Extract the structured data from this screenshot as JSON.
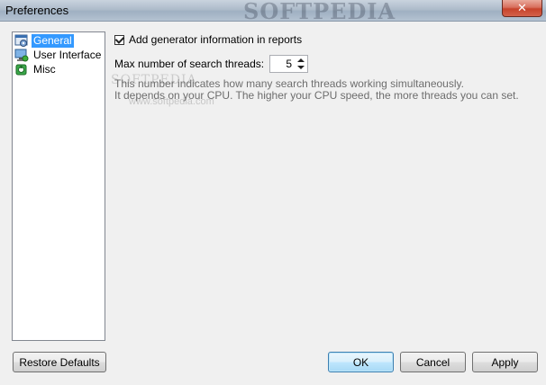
{
  "window": {
    "title": "Preferences",
    "watermark": "SOFTPEDIA",
    "close_symbol": "✕"
  },
  "sidebar": {
    "items": [
      {
        "label": "General",
        "icon": "settings-window-icon",
        "selected": true
      },
      {
        "label": "User Interface",
        "icon": "monitor-icon",
        "selected": false
      },
      {
        "label": "Misc",
        "icon": "misc-icon",
        "selected": false
      }
    ]
  },
  "general": {
    "add_generator_label": "Add generator information in reports",
    "add_generator_checked": true,
    "threads_label": "Max number of search threads:",
    "threads_value": "5",
    "hint_line1": "This number indicates how many search threads working simultaneously.",
    "hint_line2": "It depends on your CPU. The higher your CPU speed, the more threads you can set."
  },
  "watermarks": {
    "small": "www.softpedia.com",
    "big": "SOFTPEDIA"
  },
  "buttons": {
    "restore_defaults": "Restore Defaults",
    "ok": "OK",
    "cancel": "Cancel",
    "apply": "Apply"
  },
  "colors": {
    "selection": "#3399ff",
    "close_button": "#c7432b",
    "default_button_border": "#3c7fb1"
  }
}
